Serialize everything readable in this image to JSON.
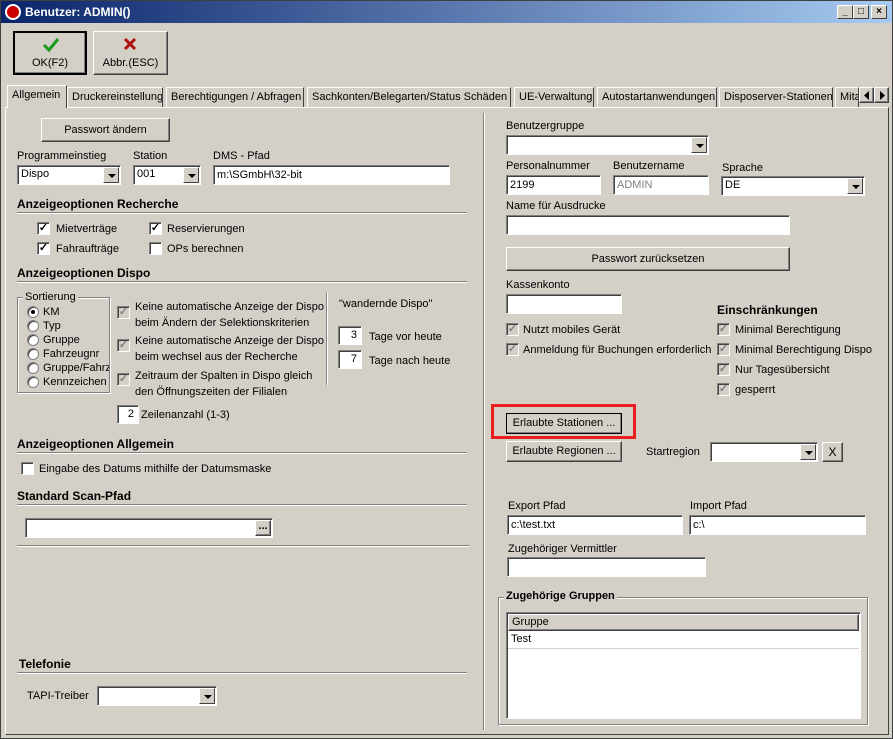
{
  "window": {
    "title": "Benutzer: ADMIN()"
  },
  "toolbar": {
    "ok_label": "OK(F2)",
    "cancel_label": "Abbr.(ESC)"
  },
  "tabs": [
    {
      "label": "Allgemein"
    },
    {
      "label": "Druckereinstellung"
    },
    {
      "label": "Berechtigungen / Abfragen"
    },
    {
      "label": "Sachkonten/Belegarten/Status Schäden"
    },
    {
      "label": "UE-Verwaltung"
    },
    {
      "label": "Autostartanwendungen"
    },
    {
      "label": "Disposerver-Stationen"
    },
    {
      "label": "Mita"
    }
  ],
  "left": {
    "password_button": "Passwort ändern",
    "programmeinstieg": {
      "label": "Programmeinstieg",
      "value": "Dispo"
    },
    "station": {
      "label": "Station",
      "value": "001"
    },
    "dms_pfad": {
      "label": "DMS - Pfad",
      "value": "m:\\SGmbH\\32-bit"
    },
    "recherche": {
      "header": "Anzeigeoptionen Recherche",
      "mietvertraege": "Mietverträge",
      "reservierungen": "Reservierungen",
      "fahrauftraege": "Fahraufträge",
      "ops": "OPs berechnen"
    },
    "dispo": {
      "header": "Anzeigeoptionen Dispo",
      "sortierung_title": "Sortierung",
      "sort_options": [
        "KM",
        "Typ",
        "Gruppe",
        "Fahrzeugnr",
        "Gruppe/Fahrz",
        "Kennzeichen"
      ],
      "opt1": "Keine automatische Anzeige der Dispo beim Ändern der Selektionskriterien",
      "opt2": "Keine automatische Anzeige der Dispo beim wechsel aus der Recherche",
      "opt3": "Zeitraum der Spalten in Dispo gleich den Öffnungszeiten der Filialen",
      "zeilen_value": "2",
      "zeilen_label": "Zeilenanzahl (1-3)",
      "wandernde": "\"wandernde Dispo\"",
      "tage_vor_value": "3",
      "tage_vor_label": "Tage vor heute",
      "tage_nach_value": "7",
      "tage_nach_label": "Tage nach heute"
    },
    "allgemein": {
      "header": "Anzeigeoptionen Allgemein",
      "datumsmaske": "Eingabe des Datums mithilfe der Datumsmaske"
    },
    "scan": {
      "header": "Standard Scan-Pfad",
      "value": "",
      "browse": "..."
    },
    "telefonie": {
      "header": "Telefonie",
      "tapi_label": "TAPI-Treiber",
      "tapi_value": ""
    }
  },
  "right": {
    "benutzergruppe": {
      "label": "Benutzergruppe",
      "value": ""
    },
    "personalnummer": {
      "label": "Personalnummer",
      "value": "2199"
    },
    "benutzername": {
      "label": "Benutzername",
      "value": "ADMIN"
    },
    "sprache": {
      "label": "Sprache",
      "value": "DE"
    },
    "name_ausdrucke": {
      "label": "Name für Ausdrucke",
      "value": ""
    },
    "reset_button": "Passwort zurücksetzen",
    "kassenkonto": {
      "label": "Kassenkonto",
      "value": ""
    },
    "mobiles": "Nutzt mobiles Gerät",
    "anmeldung": "Anmeldung für Buchungen erforderlich",
    "einschraenkungen": {
      "header": "Einschränkungen",
      "items": [
        "Minimal Berechtigung",
        "Minimal Berechtigung Dispo",
        "Nur Tagesübersicht",
        "gesperrt"
      ]
    },
    "stationen_button": "Erlaubte Stationen ...",
    "regionen_button": "Erlaubte Regionen ...",
    "startregion": {
      "label": "Startregion",
      "value": "",
      "clear": "X"
    },
    "export": {
      "label": "Export Pfad",
      "value": "c:\\test.txt"
    },
    "import": {
      "label": "Import Pfad",
      "value": "c:\\"
    },
    "vermittler": {
      "label": "Zugehöriger Vermittler",
      "value": ""
    },
    "gruppen": {
      "title": "Zugehörige Gruppen",
      "column": "Gruppe",
      "rows": [
        "Test"
      ]
    }
  },
  "colors": {
    "highlight": "#e8201e",
    "titlebar": "#0a246a",
    "ok_check": "#1a9a1a",
    "cancel_x": "#b01010"
  }
}
